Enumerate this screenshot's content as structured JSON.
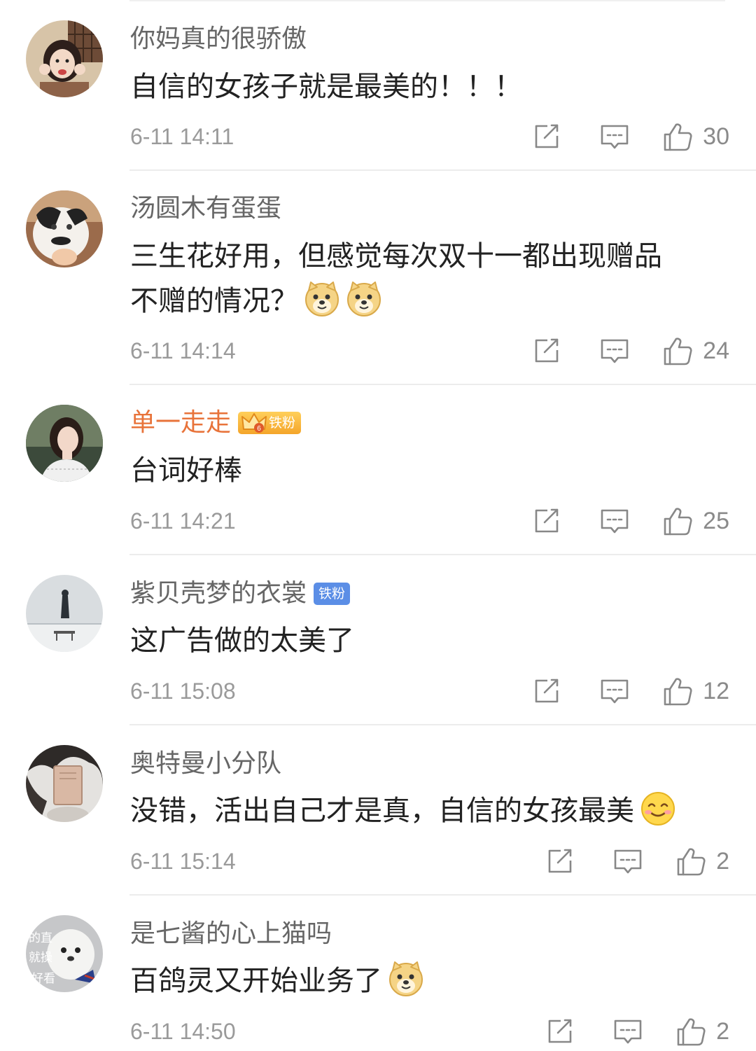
{
  "comments": [
    {
      "username": "你妈真的很骄傲",
      "text": "自信的女孩子就是最美的！！！",
      "time": "6-11 14:11",
      "likes": "30"
    },
    {
      "username": "汤圆木有蛋蛋",
      "text_line1": "三生花好用，但感觉每次双十一都出现赠品",
      "text_line2": "不赠的情况？",
      "time": "6-11 14:14",
      "likes": "24",
      "emojis": [
        "doge-emoji",
        "doge-emoji"
      ]
    },
    {
      "username": "单一走走",
      "badge": {
        "level": "6",
        "label": "铁粉",
        "color": "#f4a52a"
      },
      "text": "台词好棒",
      "time": "6-11 14:21",
      "likes": "25"
    },
    {
      "username": "紫贝壳梦的衣裳",
      "badge": {
        "label": "铁粉",
        "color": "#5b8ee6"
      },
      "text": "这广告做的太美了",
      "time": "6-11 15:08",
      "likes": "12"
    },
    {
      "username": "奥特曼小分队",
      "text": "没错，活出自己才是真，自信的女孩最美",
      "time": "6-11 15:14",
      "likes": "2",
      "emojis": [
        "smile-emoji"
      ]
    },
    {
      "username": "是七酱的心上猫吗",
      "text": "百鸽灵又开始业务了",
      "time": "6-11 14:50",
      "likes": "2",
      "emojis": [
        "doge-emoji"
      ]
    }
  ],
  "avatar_texts": {
    "c6": [
      "的直",
      "就操",
      "好看"
    ]
  },
  "colors": {
    "vip_name": "#e8733a",
    "name": "#666666",
    "text": "#222222",
    "meta": "#9a9a9a"
  },
  "icons": {
    "share": "share-icon",
    "reply": "comment-icon",
    "like": "thumbs-up-icon"
  }
}
